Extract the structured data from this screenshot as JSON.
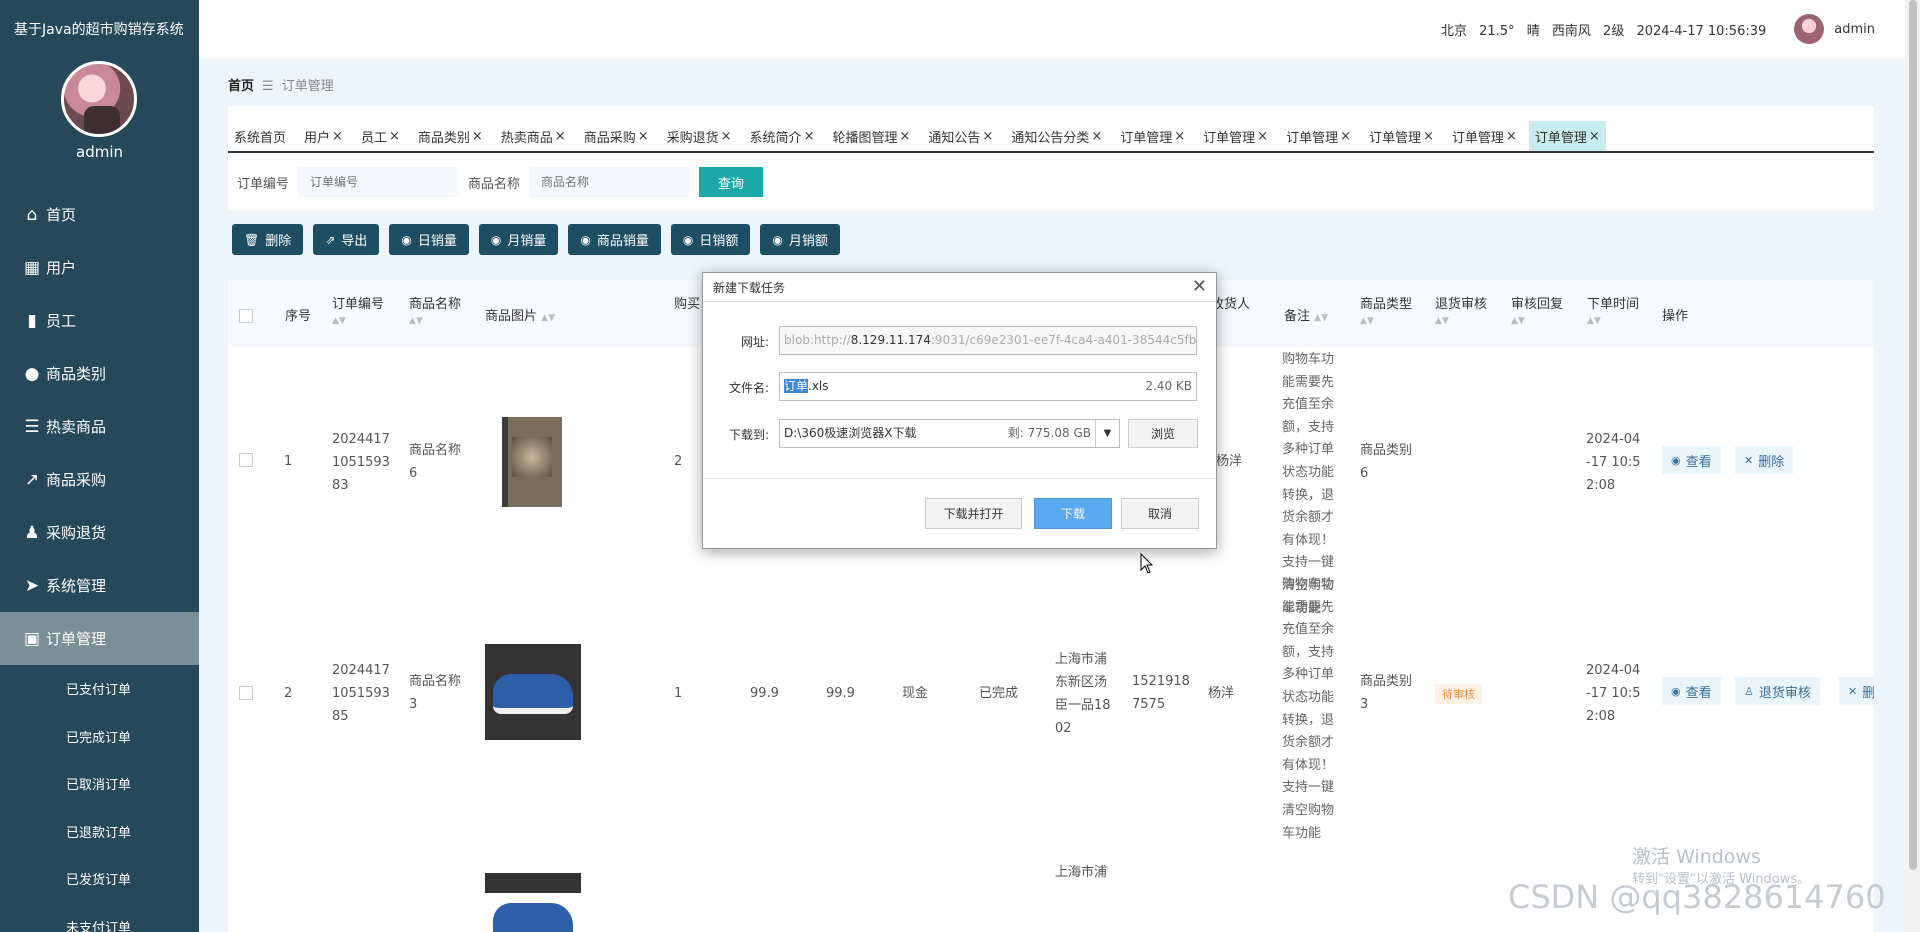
{
  "app": {
    "title": "基于Java的超市购销存系统"
  },
  "sidebar": {
    "user_name": "admin",
    "items": [
      {
        "label": "首页",
        "icon": "home-icon"
      },
      {
        "label": "用户",
        "icon": "grid-icon"
      },
      {
        "label": "员工",
        "icon": "book-icon"
      },
      {
        "label": "商品类别",
        "icon": "bulb-icon"
      },
      {
        "label": "热卖商品",
        "icon": "list-icon"
      },
      {
        "label": "商品采购",
        "icon": "chart-icon"
      },
      {
        "label": "采购退货",
        "icon": "user-icon"
      },
      {
        "label": "系统管理",
        "icon": "send-icon"
      },
      {
        "label": "订单管理",
        "icon": "clipboard-icon"
      }
    ],
    "sub_items": [
      "已支付订单",
      "已完成订单",
      "已取消订单",
      "已退款订单",
      "已发货订单",
      "未支付订单"
    ]
  },
  "topbar": {
    "city": "北京",
    "temp": "21.5°",
    "weather": "晴",
    "wind": "西南风",
    "level": "2级",
    "datetime": "2024-4-17 10:56:39",
    "user": "admin"
  },
  "breadcrumb": {
    "home": "首页",
    "sep": "☰",
    "current": "订单管理"
  },
  "tabs": [
    {
      "label": "系统首页",
      "closable": false
    },
    {
      "label": "用户",
      "closable": true
    },
    {
      "label": "员工",
      "closable": true
    },
    {
      "label": "商品类别",
      "closable": true
    },
    {
      "label": "热卖商品",
      "closable": true
    },
    {
      "label": "商品采购",
      "closable": true
    },
    {
      "label": "采购退货",
      "closable": true
    },
    {
      "label": "系统简介",
      "closable": true
    },
    {
      "label": "轮播图管理",
      "closable": true
    },
    {
      "label": "通知公告",
      "closable": true
    },
    {
      "label": "通知公告分类",
      "closable": true
    },
    {
      "label": "订单管理",
      "closable": true
    },
    {
      "label": "订单管理",
      "closable": true
    },
    {
      "label": "订单管理",
      "closable": true
    },
    {
      "label": "订单管理",
      "closable": true
    },
    {
      "label": "订单管理",
      "closable": true
    },
    {
      "label": "订单管理",
      "closable": true
    }
  ],
  "search": {
    "order_no_label": "订单编号",
    "order_no_placeholder": "订单编号",
    "product_label": "商品名称",
    "product_placeholder": "商品名称",
    "query": "查询"
  },
  "actions": [
    {
      "label": "删除",
      "icon": "trash-icon"
    },
    {
      "label": "导出",
      "icon": "export-icon"
    },
    {
      "label": "日销量",
      "icon": "circle-icon"
    },
    {
      "label": "月销量",
      "icon": "circle-icon"
    },
    {
      "label": "商品销量",
      "icon": "circle-icon"
    },
    {
      "label": "日销额",
      "icon": "circle-icon"
    },
    {
      "label": "月销额",
      "icon": "circle-icon"
    }
  ],
  "table": {
    "headers": {
      "index": "序号",
      "order_no": "订单编号",
      "product_name": "商品名称",
      "image": "商品图片",
      "qty": "购买",
      "receiver": "收货人",
      "remark": "备注",
      "category": "商品类型",
      "refund_review": "退货审核",
      "review_reply": "审核回复",
      "order_time": "下单时间",
      "operation": "操作"
    },
    "rows": [
      {
        "index": "1",
        "order_no": [
          "2024417",
          "1051593",
          "83"
        ],
        "product_name": [
          "商品名称",
          "6"
        ],
        "qty": "2",
        "receiver": "杨洋",
        "remark": [
          "购物车功",
          "能需要先",
          "充值至余",
          "额，支持",
          "多种订单",
          "状态功能",
          "转换，退",
          "货余额才",
          "有体现！",
          "支持一键",
          "清空购物",
          "车功能"
        ],
        "category": [
          "商品类别",
          "6"
        ],
        "order_time": [
          "2024-04",
          "-17 10:5",
          "2:08"
        ],
        "ops": [
          "查看",
          "删除"
        ]
      },
      {
        "index": "2",
        "order_no": [
          "2024417",
          "1051593",
          "85"
        ],
        "product_name": [
          "商品名称",
          "3"
        ],
        "qty": "1",
        "price": "99.9",
        "total": "99.9",
        "pay_type": "现金",
        "status": "已完成",
        "address": [
          "上海市浦",
          "东新区汤",
          "臣一品18",
          "02"
        ],
        "phone": [
          "1521918",
          "7575"
        ],
        "receiver": "杨洋",
        "remark": [
          "购物车功",
          "能需要先",
          "充值至余",
          "额，支持",
          "多种订单",
          "状态功能",
          "转换，退",
          "货余额才",
          "有体现！",
          "支持一键",
          "清空购物",
          "车功能"
        ],
        "category": [
          "商品类别",
          "3"
        ],
        "refund_badge": "待审核",
        "order_time": [
          "2024-04",
          "-17 10:5",
          "2:08"
        ],
        "ops": [
          "查看",
          "退货审核",
          "删"
        ]
      }
    ],
    "row3_address": "上海市浦"
  },
  "dialog": {
    "title": "新建下载任务",
    "url_label": "网址:",
    "url_prefix": "blob:http://",
    "url_host": "8.129.11.174",
    "url_rest": ":9031/c69e2301-ee7f-4ca4-a401-38544c5fb65f",
    "filename_label": "文件名:",
    "filename_selected": "订单",
    "filename_ext": ".xls",
    "filesize": "2.40 KB",
    "saveto_label": "下载到:",
    "saveto_path": "D:\\360极速浏览器X下载",
    "free_space": "剩: 775.08 GB",
    "browse": "浏览",
    "download_open": "下载并打开",
    "download": "下载",
    "cancel": "取消"
  },
  "watermark": {
    "activate": "激活 Windows",
    "activate_sub": "转到\"设置\"以激活 Windows。",
    "csdn": "CSDN @qq3828614760"
  }
}
